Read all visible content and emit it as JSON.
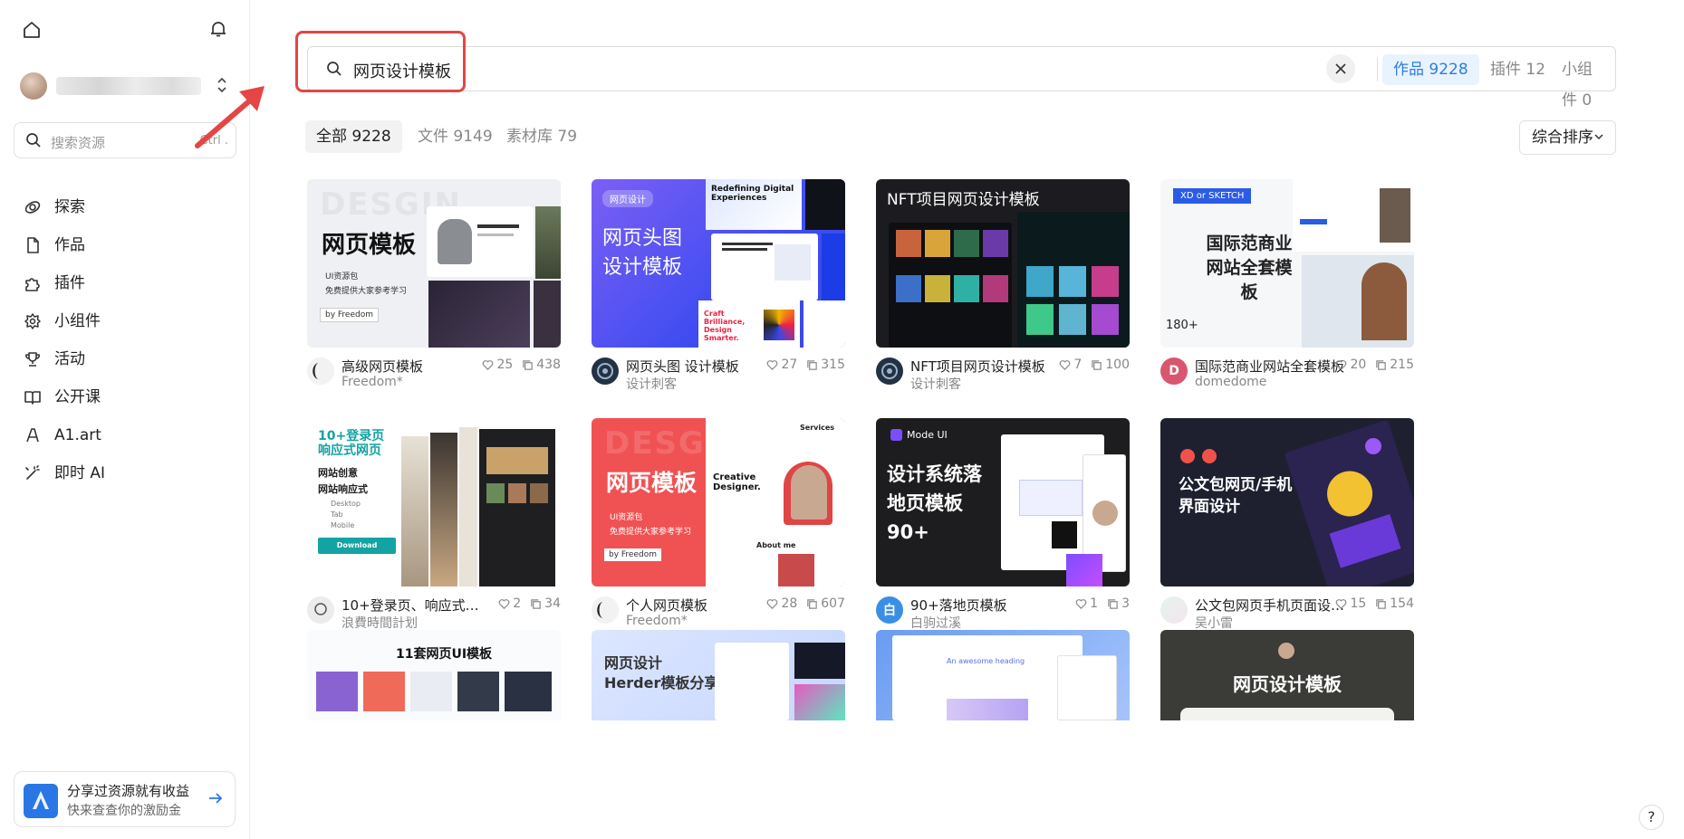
{
  "sidebar": {
    "search_placeholder": "搜索资源",
    "search_shortcut": "Ctrl .",
    "nav": [
      {
        "label": "探索",
        "icon": "explore-icon"
      },
      {
        "label": "作品",
        "icon": "file-icon"
      },
      {
        "label": "插件",
        "icon": "puzzle-icon"
      },
      {
        "label": "小组件",
        "icon": "widget-gear-icon"
      },
      {
        "label": "活动",
        "icon": "trophy-icon"
      },
      {
        "label": "公开课",
        "icon": "book-icon"
      },
      {
        "label": "A1.art",
        "icon": "pen-icon"
      },
      {
        "label": "即时 AI",
        "icon": "magic-wand-icon"
      }
    ],
    "promo": {
      "title": "分享过资源就有收益",
      "subtitle": "快来查查你的激励金"
    }
  },
  "search": {
    "query": "网页设计模板",
    "scope_tabs": [
      {
        "label": "作品 9228",
        "active": true
      },
      {
        "label": "插件 12",
        "active": false
      },
      {
        "label": "小组件 0",
        "active": false
      }
    ]
  },
  "filters": {
    "tabs": [
      {
        "label": "全部 9228",
        "active": true
      },
      {
        "label": "文件 9149",
        "active": false
      },
      {
        "label": "素材库 79",
        "active": false
      }
    ],
    "sort_label": "综合排序"
  },
  "cards": [
    {
      "title": "高级网页模板",
      "author": "Freedom*",
      "likes": "25",
      "copies": "438",
      "thumb_text": "网页模板"
    },
    {
      "title": "网页头图 设计模板",
      "author": "设计刺客",
      "likes": "27",
      "copies": "315",
      "thumb_text": "网页头图设计模板",
      "thumb_tag": "网页设计"
    },
    {
      "title": "NFT项目网页设计模板",
      "author": "设计刺客",
      "likes": "7",
      "copies": "100",
      "thumb_text": "NFT项目网页设计模板"
    },
    {
      "title": "国际范商业网站全套模板",
      "author": "domedome",
      "likes": "20",
      "copies": "215",
      "thumb_text": "国际范商业网站全套模板",
      "avatar_letter": "D"
    },
    {
      "title": "10+登录页、响应式网页…",
      "author": "浪費時間計划",
      "likes": "2",
      "copies": "34",
      "thumb_text": "10+登录页响应式网页"
    },
    {
      "title": "个人网页模板",
      "author": "Freedom*",
      "likes": "28",
      "copies": "607",
      "thumb_text": "网页模板"
    },
    {
      "title": "90+落地页模板",
      "author": "白驹过溪",
      "likes": "1",
      "copies": "3",
      "thumb_text": "设计系统落地页模板 90+",
      "avatar_letter": "白"
    },
    {
      "title": "公文包网页手机页面设…",
      "author": "吴小雷",
      "likes": "15",
      "copies": "154",
      "thumb_text": "公文包网页/手机界面设计"
    },
    {
      "title": "",
      "author": "",
      "likes": "",
      "copies": "",
      "thumb_text": "11套网页UI模板"
    },
    {
      "title": "",
      "author": "",
      "likes": "",
      "copies": "",
      "thumb_text": "网页设计 Herder模板分享"
    },
    {
      "title": "",
      "author": "",
      "likes": "",
      "copies": "",
      "thumb_text": "An awesome heading"
    },
    {
      "title": "",
      "author": "",
      "likes": "",
      "copies": "",
      "thumb_text": "网页设计模板"
    }
  ],
  "thumb_extras": {
    "design_watermark": "DESGIN",
    "ui_pack": "UI资源包",
    "free_share": "免费提供大家参考学习",
    "by_freedom": "by Freedom",
    "xd_sketch": "XD or SKETCH",
    "count_180": "180+",
    "desktop": "Desktop",
    "tab": "Tab",
    "mobile": "Mobile",
    "download": "Download",
    "mode_ui": "Mode UI",
    "creative": "Creative Designer.",
    "services": "Services",
    "about_me": "About me",
    "redefining": "Redefining Digital Experiences",
    "craft": "Craft Brilliance, Design Smarter.",
    "site_ideas": "网站创意",
    "site_responsive": "网站响应式"
  },
  "help": "?"
}
